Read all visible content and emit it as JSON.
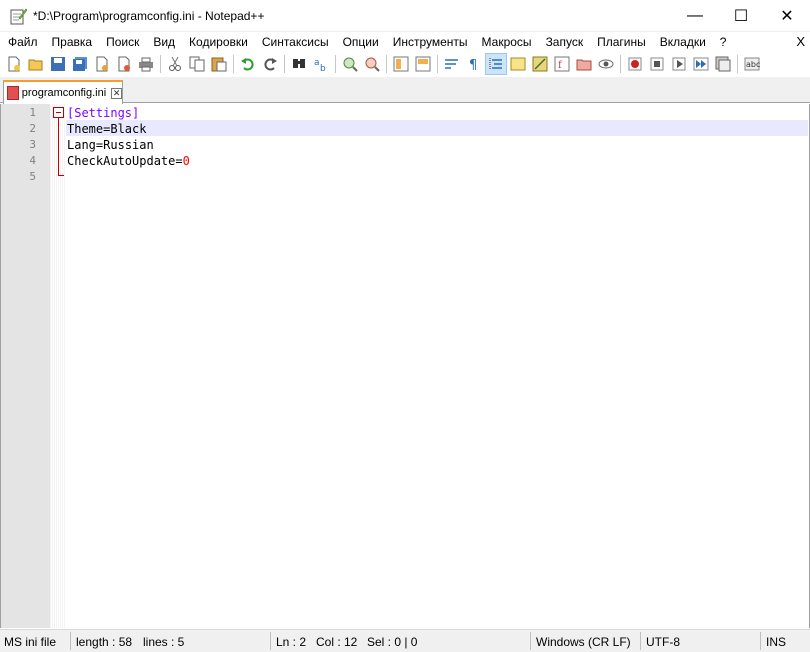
{
  "window": {
    "title": "*D:\\Program\\programconfig.ini - Notepad++",
    "minimize": "—",
    "maximize": "☐",
    "close": "✕"
  },
  "menu": {
    "items": [
      "Файл",
      "Правка",
      "Поиск",
      "Вид",
      "Кодировки",
      "Синтаксисы",
      "Опции",
      "Инструменты",
      "Макросы",
      "Запуск",
      "Плагины",
      "Вкладки",
      "?"
    ],
    "close": "X"
  },
  "toolbar": {
    "buttons": [
      "new-icon",
      "open-icon",
      "save-icon",
      "save-all-icon",
      "close-icon",
      "close-all-icon",
      "print-icon",
      "cut-icon",
      "copy-icon",
      "paste-icon",
      "undo-icon",
      "redo-icon",
      "find-icon",
      "replace-icon",
      "zoom-in-icon",
      "zoom-out-icon",
      "sync-vertical-icon",
      "sync-horizontal-icon",
      "word-wrap-icon",
      "show-all-chars-icon",
      "indent-guide-icon",
      "udl-icon",
      "doc-map-icon",
      "function-list-icon",
      "folder-workspace-icon",
      "monitoring-icon",
      "record-macro-icon",
      "stop-record-icon",
      "play-macro-icon",
      "run-macro-multiple-icon",
      "save-macro-icon",
      "spellcheck-icon"
    ],
    "active_button": "indent-guide-icon"
  },
  "tab": {
    "label": "programconfig.ini",
    "accent": "#fa9b2e"
  },
  "editor": {
    "lines": [
      {
        "num": "1",
        "tokens": [
          {
            "t": "[Settings]",
            "c": "c-section"
          }
        ]
      },
      {
        "num": "2",
        "tokens": [
          {
            "t": "Theme",
            "c": "c-key"
          },
          {
            "t": "=",
            "c": "c-eq"
          },
          {
            "t": "Black",
            "c": "c-val"
          }
        ]
      },
      {
        "num": "3",
        "tokens": [
          {
            "t": "Lang",
            "c": "c-key"
          },
          {
            "t": "=",
            "c": "c-eq"
          },
          {
            "t": "Russian",
            "c": "c-val"
          }
        ]
      },
      {
        "num": "4",
        "tokens": [
          {
            "t": "CheckAutoUpdate",
            "c": "c-key"
          },
          {
            "t": "=",
            "c": "c-eq"
          },
          {
            "t": "0",
            "c": "c-num"
          }
        ]
      },
      {
        "num": "5",
        "tokens": []
      }
    ],
    "current_line": 2,
    "section_color": "#8000ff",
    "number_color": "#ff0000",
    "current_line_color": "#e8e8ff"
  },
  "status": {
    "language": "MS ini file",
    "length": "length : 58",
    "lines": "lines : 5",
    "ln": "Ln : 2",
    "col": "Col : 12",
    "sel": "Sel : 0 | 0",
    "eol": "Windows (CR LF)",
    "encoding": "UTF-8",
    "mode": "INS"
  }
}
